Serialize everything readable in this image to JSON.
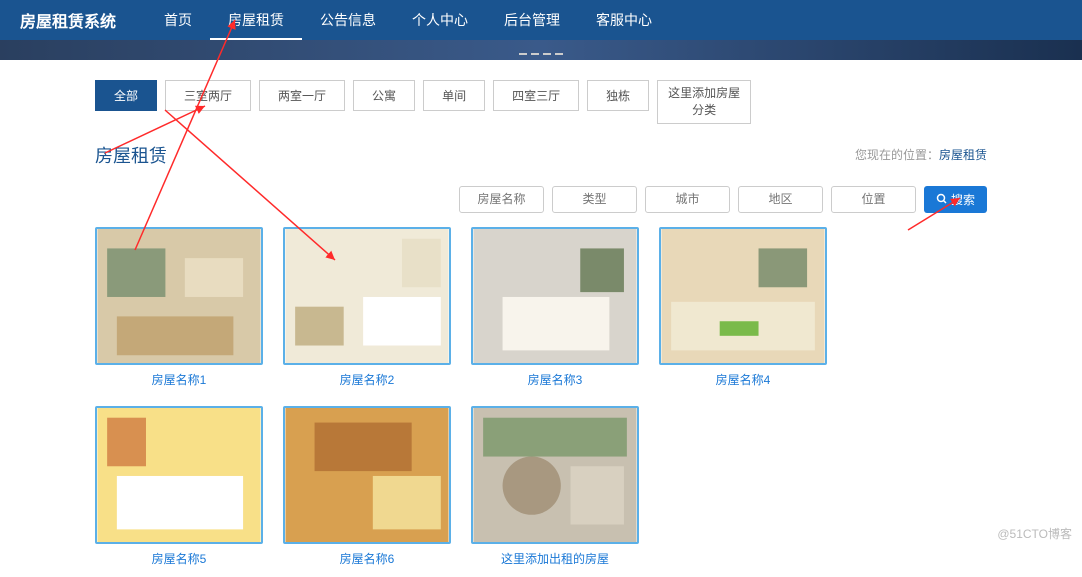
{
  "brand": "房屋租赁系统",
  "nav": {
    "items": [
      {
        "label": "首页"
      },
      {
        "label": "房屋租赁"
      },
      {
        "label": "公告信息"
      },
      {
        "label": "个人中心"
      },
      {
        "label": "后台管理"
      },
      {
        "label": "客服中心"
      }
    ],
    "activeIndex": 1
  },
  "categories": {
    "items": [
      {
        "label": "全部"
      },
      {
        "label": "三室两厅"
      },
      {
        "label": "两室一厅"
      },
      {
        "label": "公寓"
      },
      {
        "label": "单间"
      },
      {
        "label": "四室三厅"
      },
      {
        "label": "独栋"
      },
      {
        "label": "这里添加房屋\n分类"
      }
    ],
    "activeIndex": 0
  },
  "pageTitle": "房屋租赁",
  "breadcrumb": {
    "prefix": "您现在的位置：",
    "current": "房屋租赁"
  },
  "filters": {
    "fields": [
      {
        "placeholder": "房屋名称"
      },
      {
        "placeholder": "类型"
      },
      {
        "placeholder": "城市"
      },
      {
        "placeholder": "地区"
      },
      {
        "placeholder": "位置"
      }
    ],
    "searchLabel": "搜索"
  },
  "listings": [
    {
      "title": "房屋名称1"
    },
    {
      "title": "房屋名称2"
    },
    {
      "title": "房屋名称3"
    },
    {
      "title": "房屋名称4"
    },
    {
      "title": "房屋名称5"
    },
    {
      "title": "房屋名称6"
    },
    {
      "title": "这里添加出租的房屋"
    }
  ],
  "watermark": "@51CTO博客"
}
